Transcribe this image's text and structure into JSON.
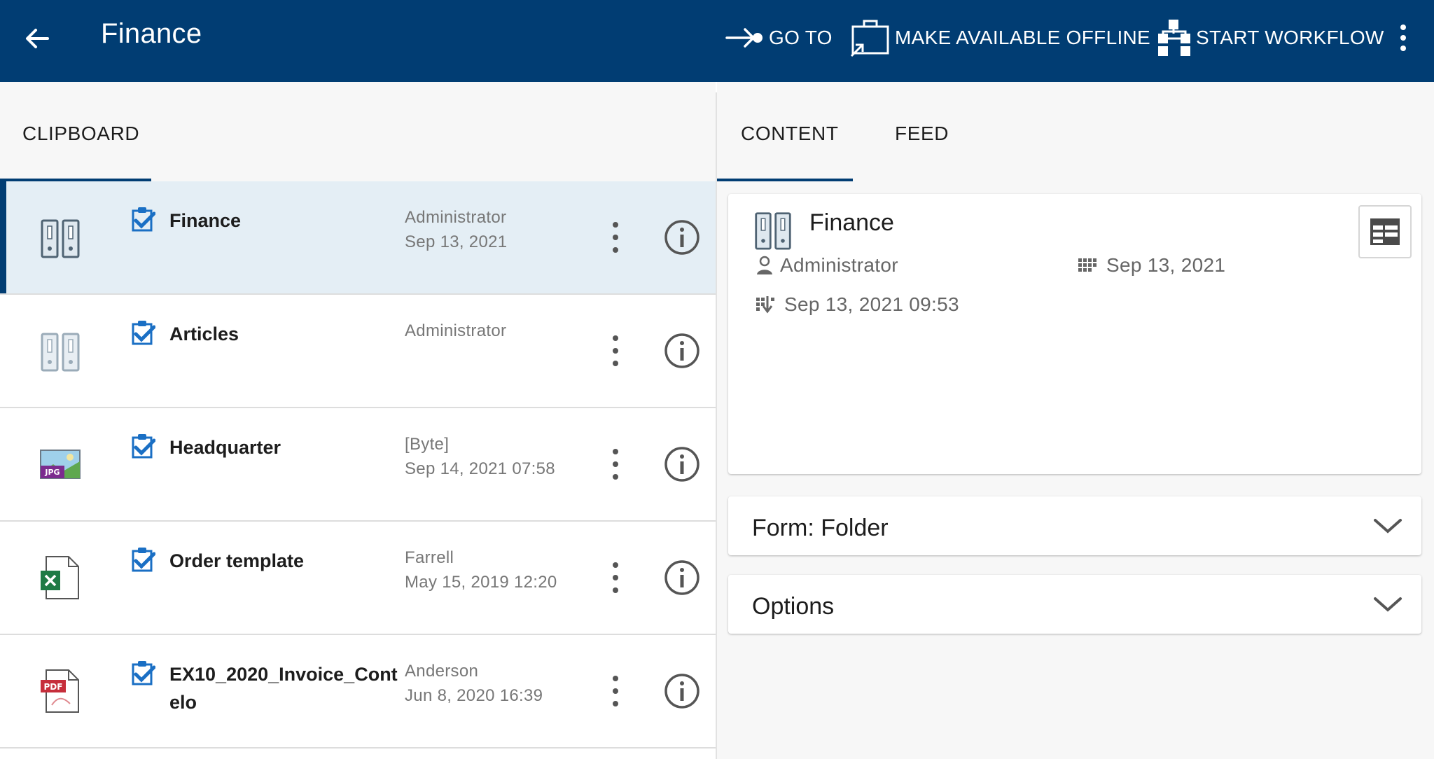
{
  "header": {
    "title": "Finance",
    "actions": {
      "goto": "GO TO",
      "offline": "MAKE AVAILABLE OFFLINE",
      "workflow": "START WORKFLOW"
    }
  },
  "left": {
    "tab": "CLIPBOARD"
  },
  "items": [
    {
      "name": "Finance",
      "meta1": "Administrator",
      "meta2": "Sep 13, 2021",
      "icon": "folder-icon"
    },
    {
      "name": "Articles",
      "meta1": "Administrator",
      "meta2": "",
      "icon": "folder-icon"
    },
    {
      "name": "Headquarter",
      "meta1": "[Byte]",
      "meta2": "Sep 14, 2021 07:58",
      "icon": "jpg-file-icon"
    },
    {
      "name": "Order template",
      "meta1": "Farrell",
      "meta2": "May 15, 2019 12:20",
      "icon": "excel-file-icon"
    },
    {
      "name": "EX10_2020_Invoice_Contelo",
      "meta1": "Anderson",
      "meta2": "Jun 8, 2020 16:39",
      "icon": "pdf-file-icon"
    }
  ],
  "right": {
    "tabs": {
      "content": "CONTENT",
      "feed": "FEED"
    },
    "detail": {
      "title": "Finance",
      "owner": "Administrator",
      "date": "Sep 13, 2021",
      "modified": "Sep 13, 2021 09:53"
    },
    "sections": {
      "form": "Form: Folder",
      "options": "Options"
    }
  },
  "colors": {
    "header_bg": "#013d73",
    "selected_row": "#e4eef5",
    "accent": "#1a6fc4"
  }
}
